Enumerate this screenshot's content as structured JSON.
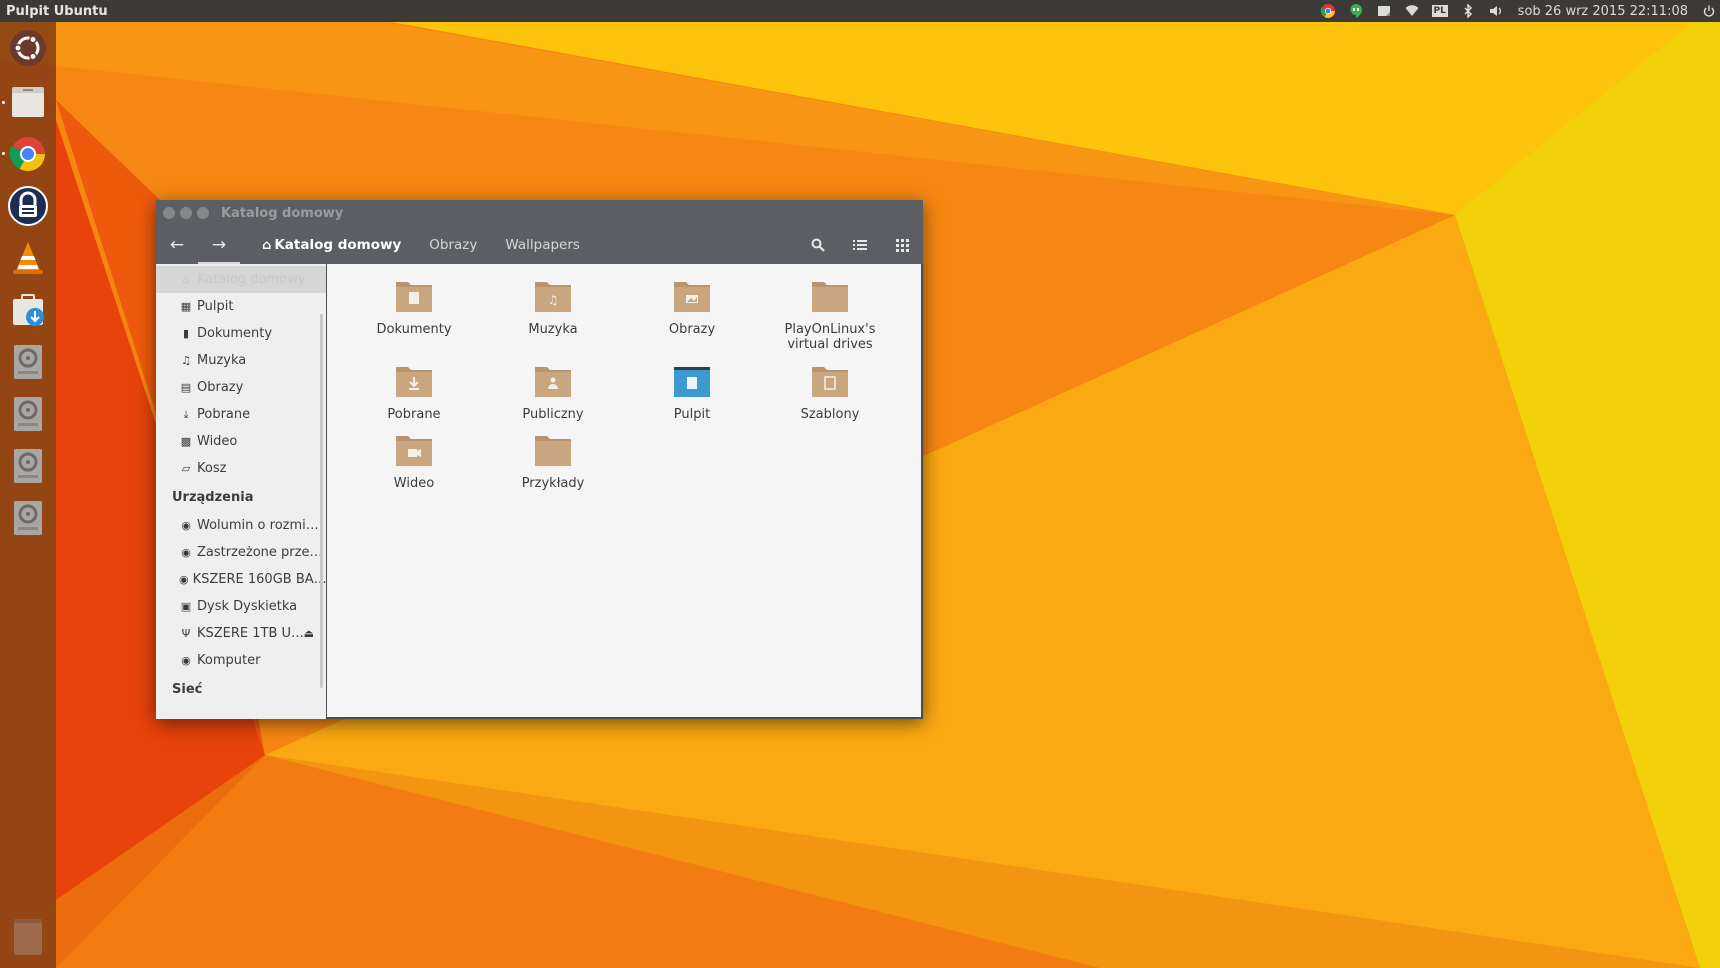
{
  "panel": {
    "title": "Pulpit Ubuntu",
    "keyboard_layout": "PL",
    "clock": "sob 26 wrz 2015 22:11:08",
    "tray_icons": [
      "chrome-icon",
      "hangouts-icon",
      "notes-icon",
      "wifi-icon",
      "keyboard-icon",
      "bluetooth-icon",
      "volume-icon",
      "power-icon"
    ]
  },
  "launcher": {
    "items": [
      "ubuntu-dash-icon",
      "files-icon",
      "chrome-icon",
      "keepass-icon",
      "vlc-icon",
      "software-updater-icon",
      "drive-icon",
      "drive-icon",
      "drive-icon",
      "drive-icon",
      "trash-icon"
    ]
  },
  "window": {
    "title": "Katalog domowy",
    "breadcrumbs": [
      {
        "label": "Katalog domowy",
        "current": true
      },
      {
        "label": "Obrazy",
        "current": false
      },
      {
        "label": "Wallpapers",
        "current": false
      }
    ],
    "sidebar": {
      "places": [
        {
          "label": "Katalog domowy",
          "icon": "home-icon",
          "selected": true
        },
        {
          "label": "Pulpit",
          "icon": "desktop-icon"
        },
        {
          "label": "Dokumenty",
          "icon": "document-icon"
        },
        {
          "label": "Muzyka",
          "icon": "music-icon"
        },
        {
          "label": "Obrazy",
          "icon": "image-icon"
        },
        {
          "label": "Pobrane",
          "icon": "download-icon"
        },
        {
          "label": "Wideo",
          "icon": "video-icon"
        },
        {
          "label": "Kosz",
          "icon": "trash-icon"
        }
      ],
      "devices_heading": "Urządzenia",
      "devices": [
        {
          "label": "Wolumin o rozmi…",
          "icon": "drive-icon"
        },
        {
          "label": "Zastrzeżone prze…",
          "icon": "drive-icon"
        },
        {
          "label": "KSZERE 160GB BA…",
          "icon": "drive-icon"
        },
        {
          "label": "Dysk Dyskietka",
          "icon": "floppy-icon"
        },
        {
          "label": "KSZERE 1TB U…",
          "icon": "usb-icon",
          "eject": true
        },
        {
          "label": "Komputer",
          "icon": "drive-icon"
        }
      ],
      "network_heading": "Sieć"
    },
    "files": [
      {
        "label": "Dokumenty",
        "emblem": "document"
      },
      {
        "label": "Muzyka",
        "emblem": "music"
      },
      {
        "label": "Obrazy",
        "emblem": "image"
      },
      {
        "label": "PlayOnLinux's virtual drives",
        "emblem": "none"
      },
      {
        "label": "Pobrane",
        "emblem": "download"
      },
      {
        "label": "Publiczny",
        "emblem": "user"
      },
      {
        "label": "Pulpit",
        "emblem": "desktop"
      },
      {
        "label": "Szablony",
        "emblem": "template"
      },
      {
        "label": "Wideo",
        "emblem": "video"
      },
      {
        "label": "Przykłady",
        "emblem": "none"
      }
    ]
  },
  "colors": {
    "folder": "#c9a680",
    "folder_tab": "#b8956f",
    "desktop_folder": "#3d9ad1",
    "panel": "#3b3a36",
    "window_header": "#5b5e62"
  }
}
